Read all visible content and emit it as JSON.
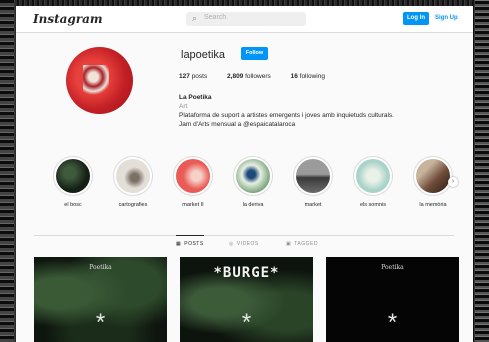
{
  "header": {
    "logo": "Instagram",
    "search_placeholder": "Search",
    "login_label": "Log In",
    "signup_label": "Sign Up"
  },
  "profile": {
    "username": "lapoetika",
    "follow_label": "Follow",
    "stats": {
      "posts_count": "127",
      "posts_label": "posts",
      "followers_count": "2,809",
      "followers_label": "followers",
      "following_count": "16",
      "following_label": "following"
    },
    "full_name": "La Poetika",
    "category": "Art",
    "bio_line1": "Plataforma de suport a artistes emergents i joves amb inquietuds culturals.",
    "bio_line2": "Jam d'Arts mensual a @espaicatalaroca"
  },
  "highlights": [
    {
      "label": "el bosc",
      "color": "#1d2b1d"
    },
    {
      "label": "cartografies",
      "color": "#d9d4cc"
    },
    {
      "label": "market II",
      "color": "#e95b57"
    },
    {
      "label": "la deriva",
      "color": "#c9d8c9"
    },
    {
      "label": "market",
      "color": "#6c6c6c"
    },
    {
      "label": "els somnis",
      "color": "#b8d8cf"
    },
    {
      "label": "la memòria",
      "color": "#8a6a55"
    }
  ],
  "tabs": [
    {
      "label": "POSTS",
      "icon": "grid-icon",
      "active": true
    },
    {
      "label": "VIDEOS",
      "icon": "video-icon",
      "active": false
    },
    {
      "label": "TAGGED",
      "icon": "tag-icon",
      "active": false
    }
  ],
  "posts": [
    {
      "title": "Poetika",
      "symbol": "*"
    },
    {
      "title": "*BURGE*",
      "symbol": "*"
    },
    {
      "title": "Poetika",
      "symbol": "*"
    }
  ],
  "colors": {
    "accent": "#0095f6",
    "avatar": "#c11f25"
  }
}
